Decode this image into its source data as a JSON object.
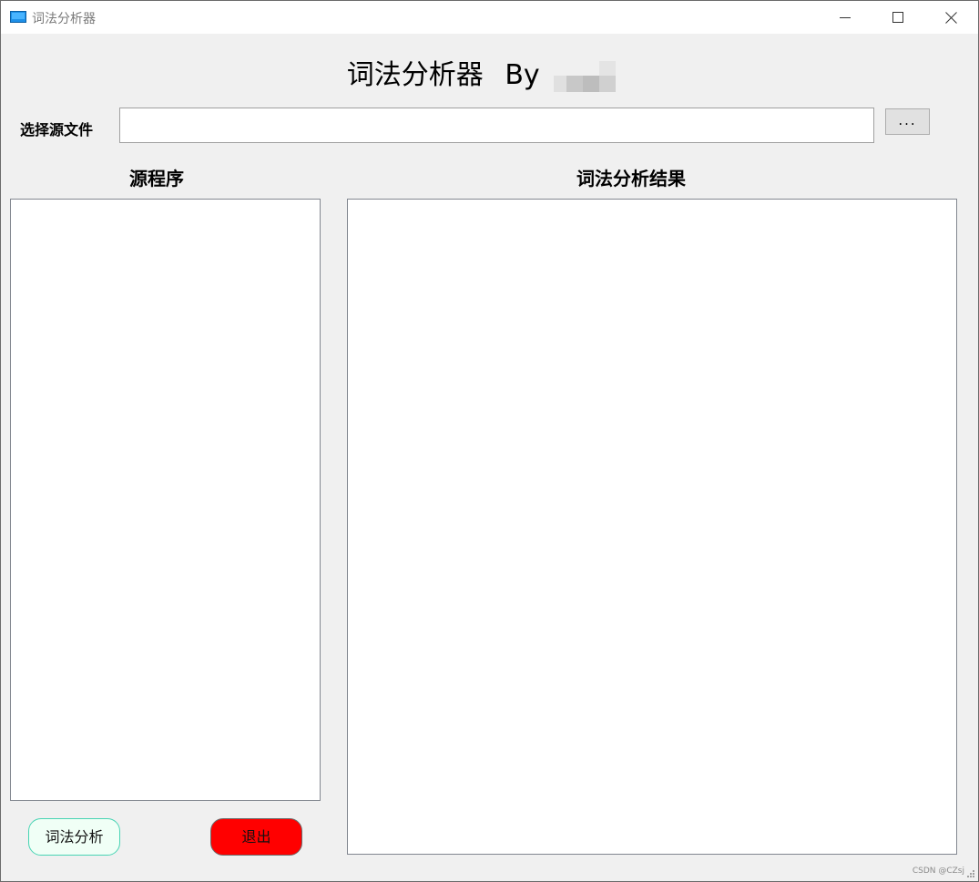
{
  "window": {
    "title": "词法分析器",
    "controls": [
      "minimize",
      "maximize",
      "close"
    ],
    "icon": "app-window-icon"
  },
  "header": {
    "title": "词法分析器",
    "by_label": "By"
  },
  "file_select": {
    "label": "选择源文件",
    "value": "",
    "browse_label": "..."
  },
  "panels": {
    "source_title": "源程序",
    "result_title": "词法分析结果",
    "source_text": "",
    "result_text": ""
  },
  "buttons": {
    "analyze_label": "词法分析",
    "exit_label": "退出"
  },
  "colors": {
    "analyze_border": "#49d4b4",
    "analyze_bg": "#f0fff6",
    "exit_bg": "#ff0000",
    "window_bg": "#f0f0f0"
  },
  "watermark": "CSDN @CZsj"
}
